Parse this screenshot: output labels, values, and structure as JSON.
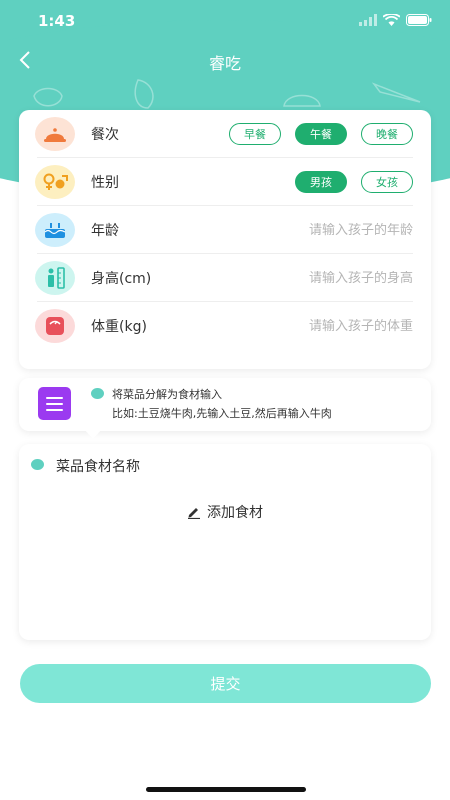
{
  "status_bar": {
    "time": "1:43"
  },
  "nav": {
    "title": "睿吃"
  },
  "form": {
    "meal": {
      "label": "餐次",
      "options": [
        "早餐",
        "午餐",
        "晚餐"
      ],
      "selected": "午餐"
    },
    "gender": {
      "label": "性别",
      "options": [
        "男孩",
        "女孩"
      ],
      "selected": "男孩"
    },
    "age": {
      "label": "年龄",
      "placeholder": "请输入孩子的年龄",
      "value": ""
    },
    "height": {
      "label": "身高(cm)",
      "placeholder": "请输入孩子的身高",
      "value": ""
    },
    "weight": {
      "label": "体重(kg)",
      "placeholder": "请输入孩子的体重",
      "value": ""
    }
  },
  "tip": {
    "line1": "将菜品分解为食材输入",
    "line2": "比如:土豆烧牛肉,先输入土豆,然后再输入牛肉"
  },
  "food": {
    "title": "菜品食材名称",
    "add_label": "添加食材"
  },
  "submit_label": "提交",
  "colors": {
    "header": "#5fd0c0",
    "accent_green": "#1fae6f",
    "submit": "#7fe6d6"
  }
}
